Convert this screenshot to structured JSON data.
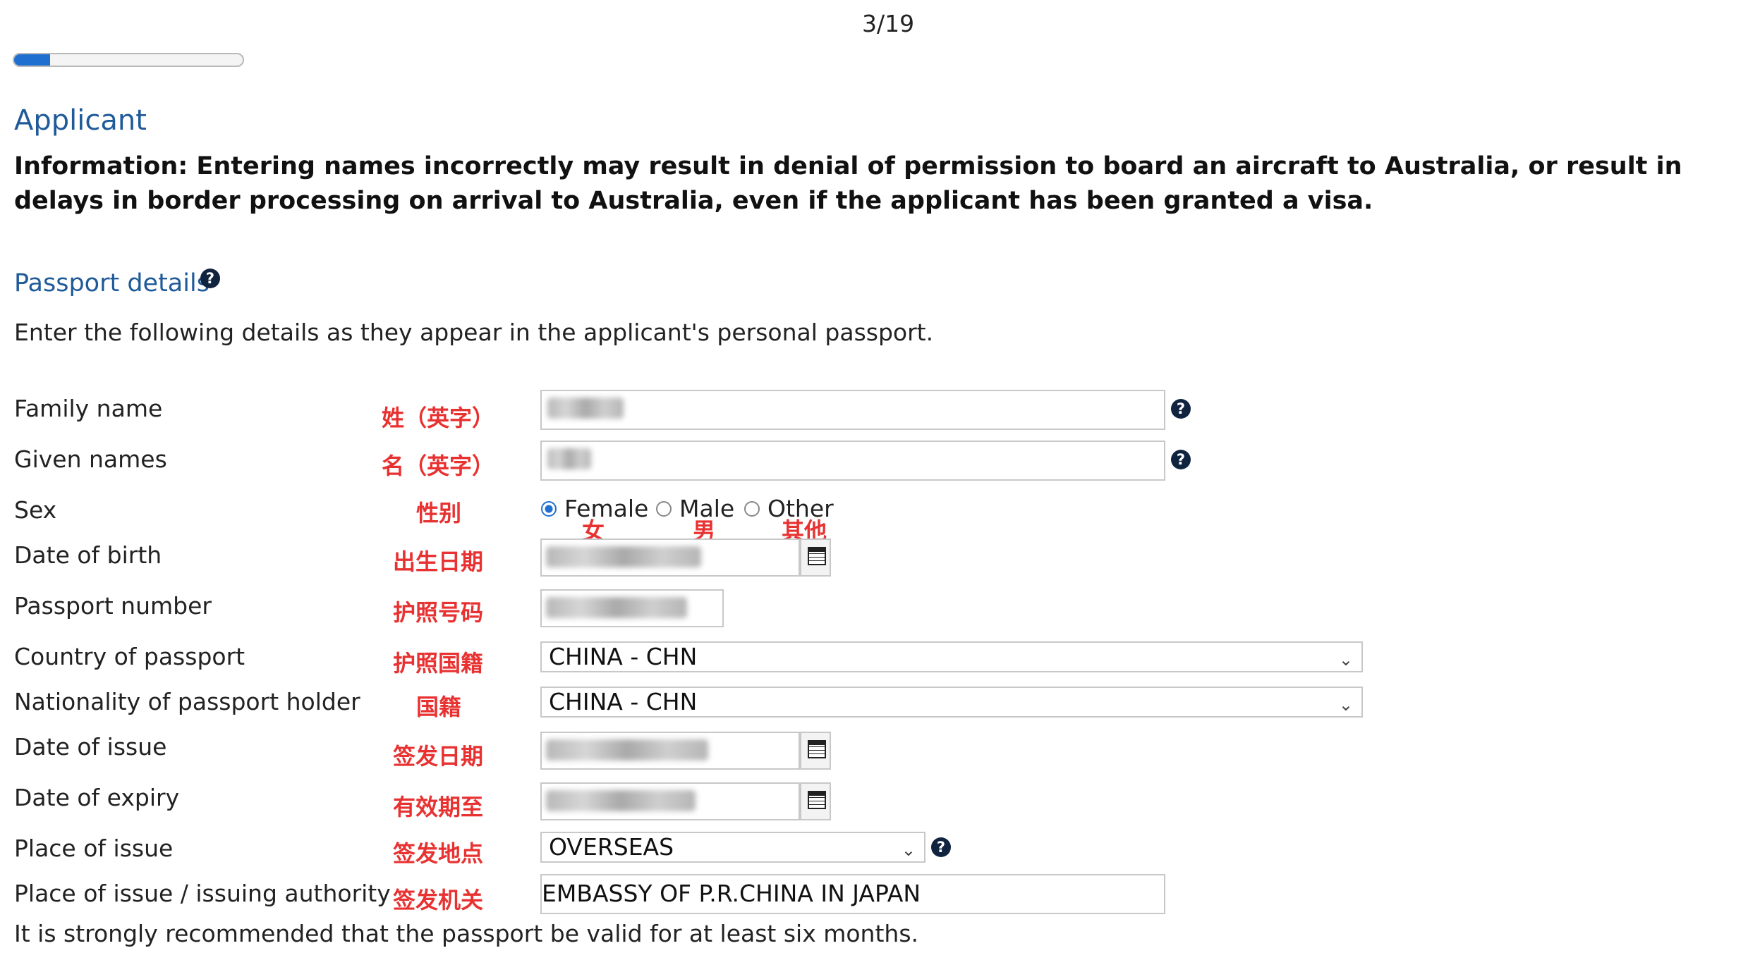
{
  "progress": {
    "step_text": "3/19",
    "fraction": 0.158
  },
  "section_title": "Applicant",
  "info_text": "Information: Entering names incorrectly may result in denial of permission to board an aircraft to Australia, or result in delays in border processing on arrival to Australia, even if the applicant has been granted a visa.",
  "passport": {
    "title": "Passport details",
    "instruction": "Enter the following details as they appear in the applicant's personal passport.",
    "labels": {
      "family_name": "Family name",
      "given_names": "Given names",
      "sex": "Sex",
      "dob": "Date of birth",
      "passport_number": "Passport number",
      "country": "Country of passport",
      "nationality": "Nationality of passport holder",
      "issue_date": "Date of issue",
      "expiry_date": "Date of expiry",
      "place_of_issue": "Place of issue",
      "issuing_authority": "Place of issue / issuing authority"
    },
    "annotations": {
      "family_name": "姓（英字）",
      "given_names": "名（英字）",
      "sex": "性别",
      "dob": "出生日期",
      "passport_number": "护照号码",
      "country": "护照国籍",
      "nationality": "国籍",
      "issue_date": "签发日期",
      "expiry_date": "有效期至",
      "place_of_issue": "签发地点",
      "issuing_authority": "签发机关",
      "female": "女",
      "male": "男",
      "other": "其他"
    },
    "sex_options": {
      "female": "Female",
      "male": "Male",
      "other": "Other",
      "selected": "Female"
    },
    "values": {
      "country": "CHINA - CHN",
      "nationality": "CHINA - CHN",
      "place_of_issue": "OVERSEAS",
      "issuing_authority": "EMBASSY OF P.R.CHINA IN JAPAN"
    },
    "note": "It is strongly recommended that the passport be valid for at least six months."
  },
  "colors": {
    "accent": "#1f6fd1",
    "heading": "#1f5a99",
    "annotation": "#e83232"
  },
  "icons": {
    "help": "question-circle-icon",
    "calendar": "calendar-icon",
    "dropdown": "chevron-down-icon"
  }
}
